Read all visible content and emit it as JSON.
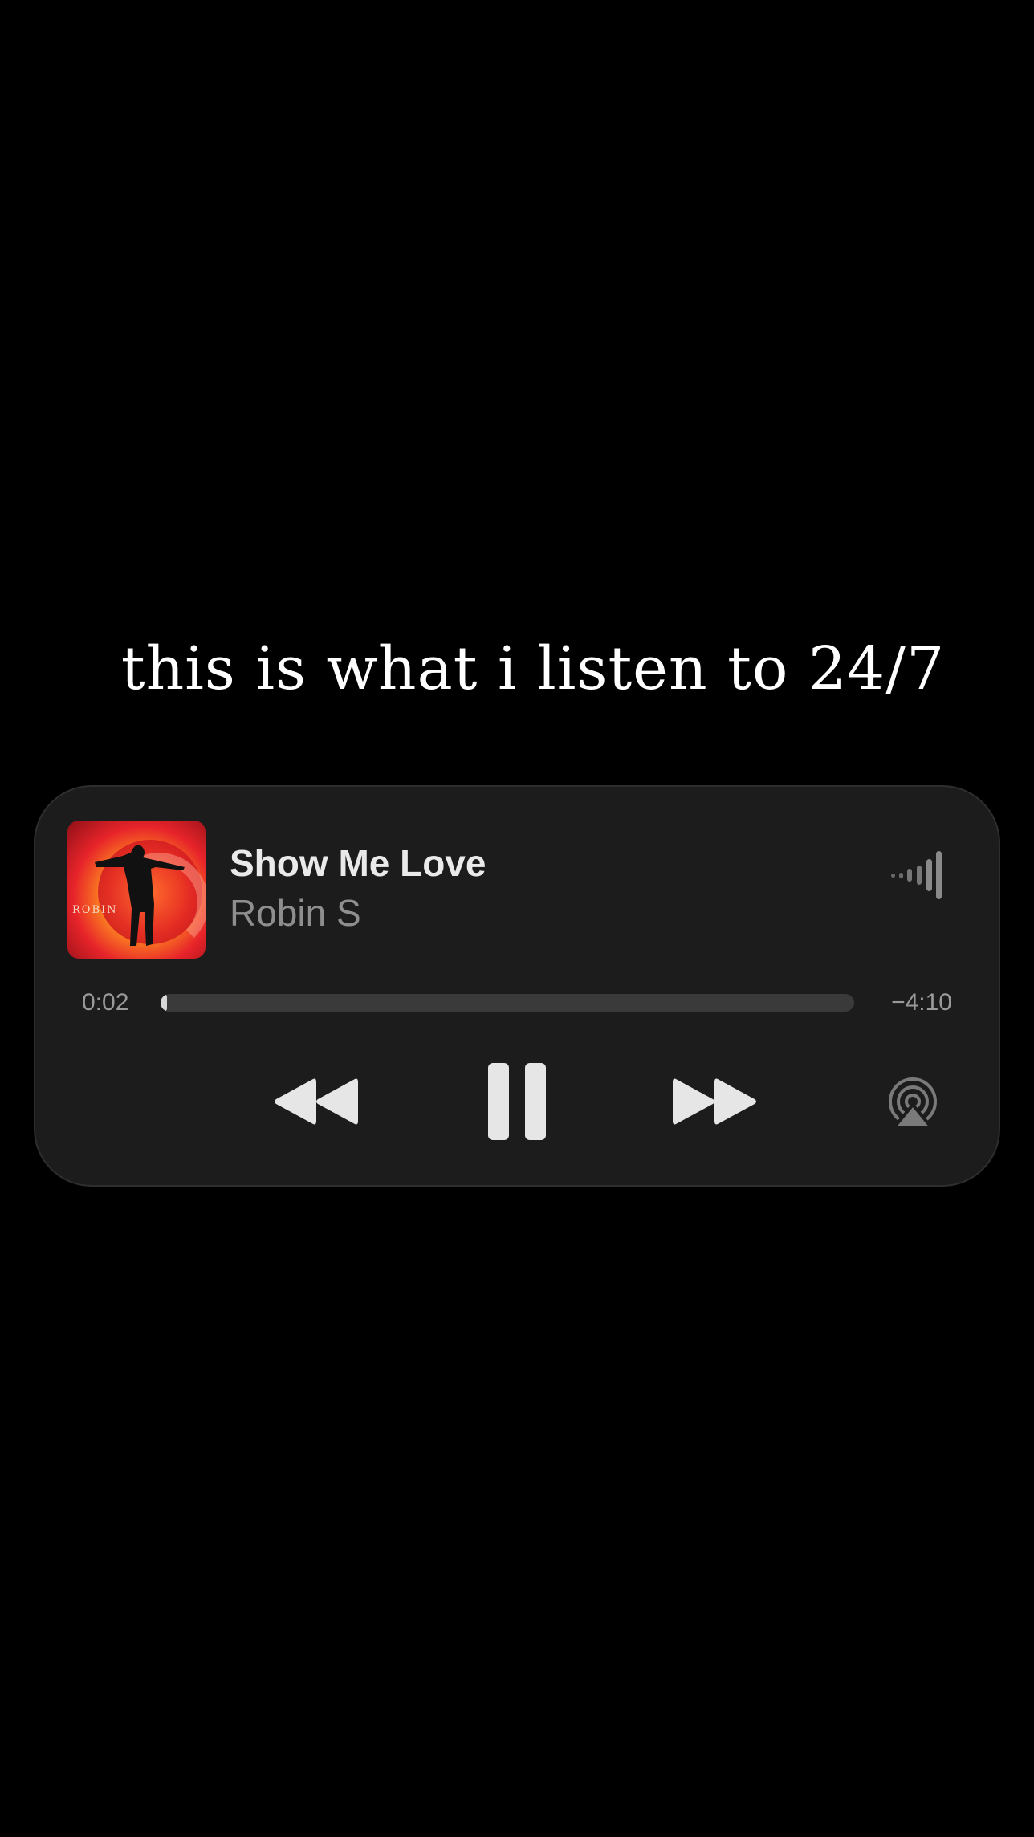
{
  "caption": "this is what i listen to 24/7",
  "player": {
    "album_art_text": "ROBIN",
    "track_title": "Show Me Love",
    "artist": "Robin S",
    "time_elapsed": "0:02",
    "time_remaining": "−4:10",
    "progress_fraction": 0.008,
    "state": "playing",
    "icons": {
      "waveform": "audio-waveform-icon",
      "rewind": "rewind-icon",
      "pause": "pause-icon",
      "forward": "fast-forward-icon",
      "airplay": "airplay-icon"
    }
  },
  "colors": {
    "background": "#000000",
    "card": "#1c1c1c",
    "primary_text": "#eaeaea",
    "secondary_text": "#8e8e8e"
  }
}
